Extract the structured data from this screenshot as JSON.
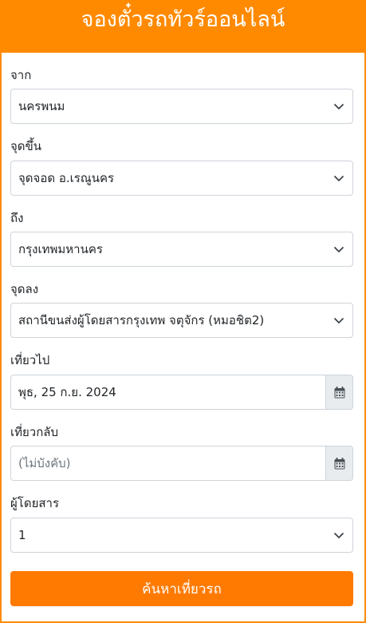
{
  "header": {
    "title": "จองตั๋วรถทัวร์ออนไลน์"
  },
  "form": {
    "from": {
      "label": "จาก",
      "value": "นครพนม"
    },
    "pickup": {
      "label": "จุดขึ้น",
      "value": "จุดจอด อ.เรณูนคร"
    },
    "to": {
      "label": "ถึง",
      "value": "กรุงเทพมหานคร"
    },
    "dropoff": {
      "label": "จุดลง",
      "value": "สถานีขนส่งผู้โดยสารกรุงเทพ จตุจักร (หมอชิต2)"
    },
    "depart": {
      "label": "เที่ยวไป",
      "value": "พุธ, 25 ก.ย. 2024"
    },
    "return": {
      "label": "เที่ยวกลับ",
      "placeholder": "(ไม่บังคับ)"
    },
    "passengers": {
      "label": "ผู้โดยสาร",
      "value": "1"
    },
    "search_label": "ค้นหาเที่ยวรถ"
  },
  "icons": {
    "dropdown": "chevron-down-icon",
    "calendar": "calendar-icon"
  },
  "colors": {
    "brand": "#ff8a00",
    "button": "#ff7a00"
  }
}
